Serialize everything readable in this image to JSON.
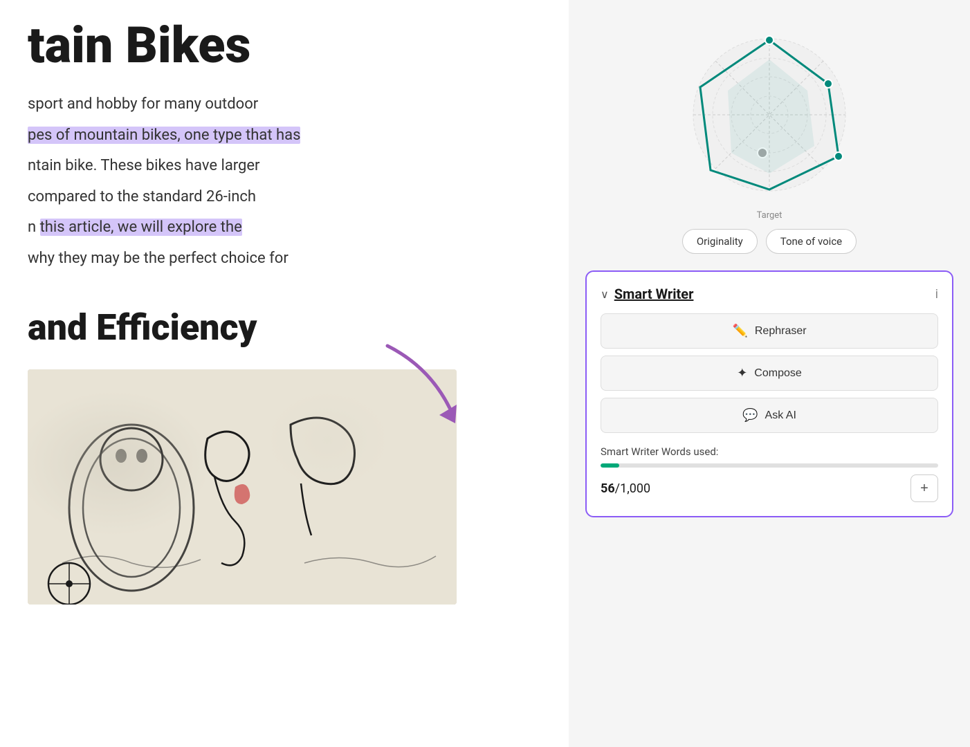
{
  "left": {
    "title": "tain Bikes",
    "paragraphs": [
      {
        "id": 1,
        "segments": [
          {
            "text": "sport and hobby for many outdoor",
            "highlight": false
          },
          {
            "text": "",
            "highlight": false
          }
        ]
      },
      {
        "id": 2,
        "segments": [
          {
            "text": "pes of mountain bikes, one type that has",
            "highlight": true
          }
        ]
      },
      {
        "id": 3,
        "segments": [
          {
            "text": "ntain bike",
            "highlight": false
          },
          {
            "text": ". These bikes have larger",
            "highlight": false
          }
        ]
      },
      {
        "id": 4,
        "segments": [
          {
            "text": "compared to the standard 26-inch",
            "highlight": false
          }
        ]
      },
      {
        "id": 5,
        "segments": [
          {
            "text": "n ",
            "highlight": false
          },
          {
            "text": "this article, we will explore the",
            "highlight": true
          }
        ]
      },
      {
        "id": 6,
        "segments": [
          {
            "text": "why they may be the perfect choice for",
            "highlight": false
          }
        ]
      }
    ],
    "section_heading": "and Efficiency"
  },
  "radar": {
    "target_label": "Target"
  },
  "badges": [
    {
      "label": "Originality",
      "id": "originality"
    },
    {
      "label": "Tone of voice",
      "id": "tone-of-voice"
    }
  ],
  "smart_writer": {
    "title": "Smart Writer",
    "chevron": "∨",
    "info": "i",
    "buttons": [
      {
        "label": "Rephraser",
        "icon": "✏",
        "id": "rephraser"
      },
      {
        "label": "Compose",
        "icon": "✦",
        "id": "compose"
      },
      {
        "label": "Ask AI",
        "icon": "□",
        "id": "ask-ai"
      }
    ],
    "words_used_label": "Smart Writer Words used:",
    "words_used_current": "56",
    "words_used_total": "1,000",
    "progress_percent": 5.6,
    "plus_label": "+"
  }
}
